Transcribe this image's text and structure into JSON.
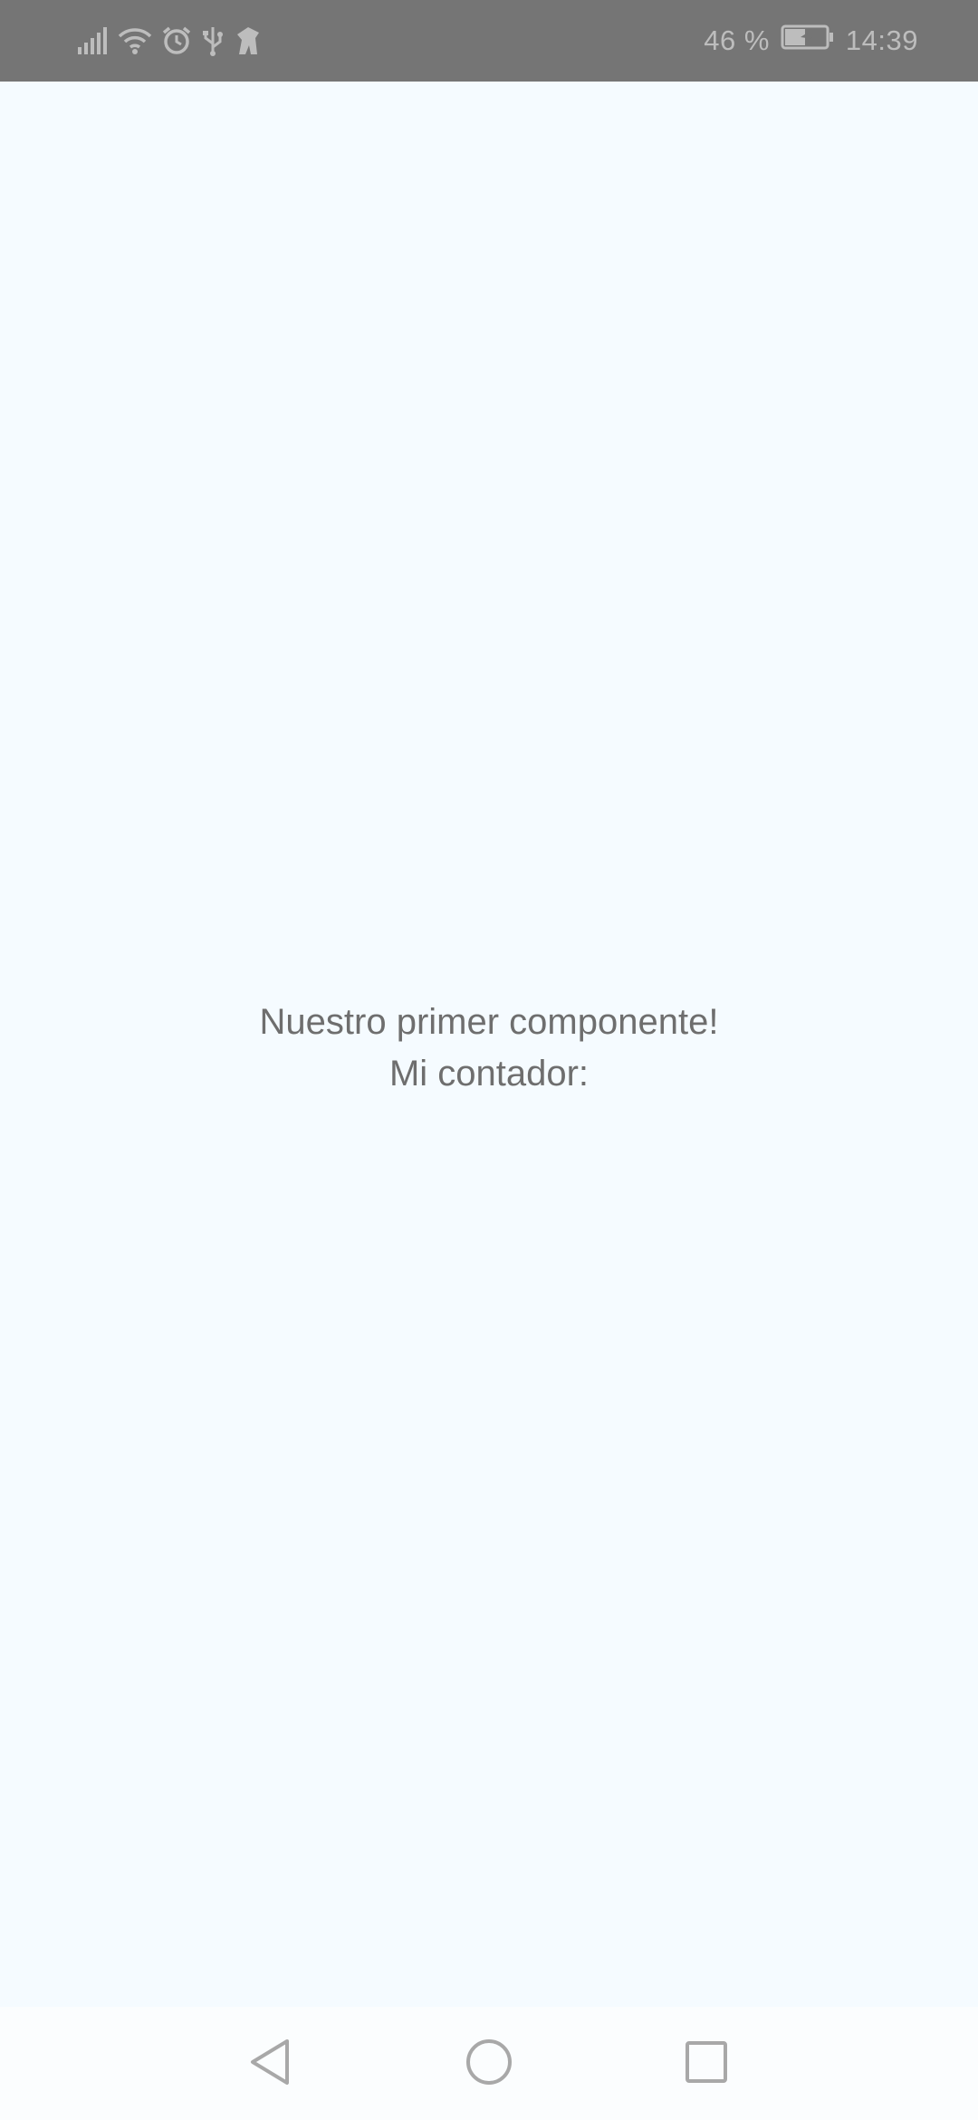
{
  "status_bar": {
    "battery_percent": "46 %",
    "time": "14:39",
    "icons": [
      "signal-icon",
      "wifi-icon",
      "alarm-icon",
      "usb-icon",
      "notification-app-icon",
      "battery-charging-icon"
    ]
  },
  "main": {
    "line1": "Nuestro primer componente!",
    "line2": "Mi contador:"
  },
  "navigation": {
    "buttons": [
      "back-icon",
      "home-icon",
      "recents-icon"
    ]
  },
  "colors": {
    "background": "#f5fbff",
    "status_bar": "#757575",
    "text": "#6e6e6e",
    "nav_icon": "#a8a8a8"
  }
}
